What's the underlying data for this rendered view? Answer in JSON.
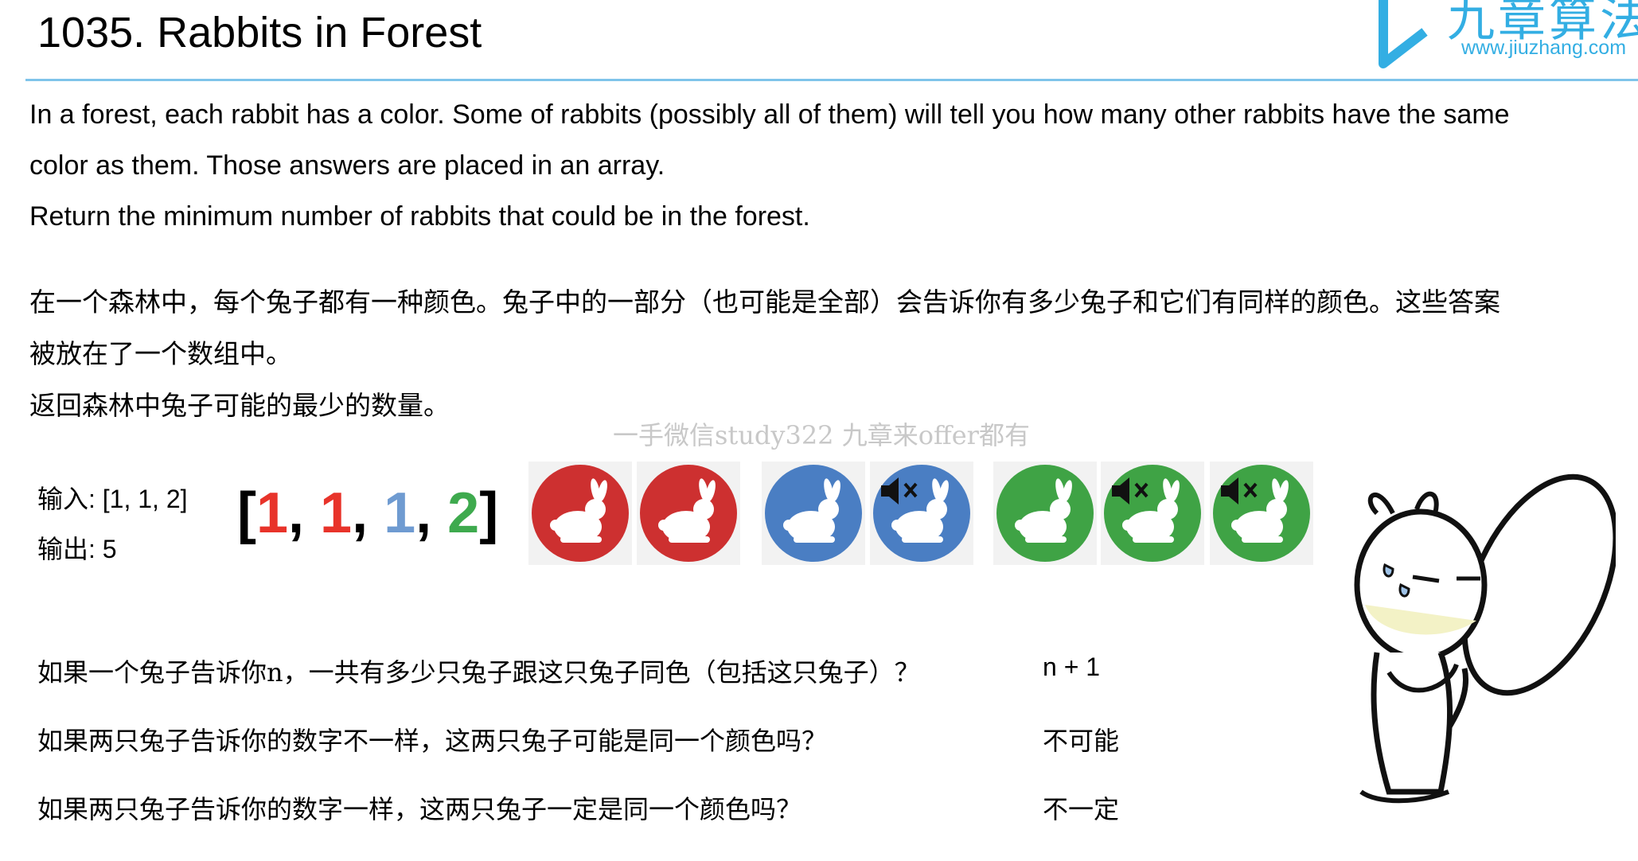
{
  "title": "1035. Rabbits in Forest",
  "logo": {
    "text": "九章算法",
    "url": "www.jiuzhang.com"
  },
  "description_en": [
    "In a forest, each rabbit has a color. Some of rabbits (possibly all of them) will tell you how many other rabbits have the same",
    "color as them. Those answers are placed in an array.",
    "Return the minimum number of rabbits that could be in the forest."
  ],
  "description_cn": [
    "在一个森林中，每个兔子都有一种颜色。兔子中的一部分（也可能是全部）会告诉你有多少兔子和它们有同样的颜色。这些答案",
    "被放在了一个数组中。",
    "返回森林中兔子可能的最少的数量。"
  ],
  "watermark": "一手微信study322 九章来offer都有",
  "example": {
    "input_label": "输入: [1, 1, 2]",
    "output_label": "输出: 5",
    "array": {
      "open": "[",
      "close": "]",
      "sep": ", ",
      "items": [
        {
          "value": "1",
          "color": "#e8332a"
        },
        {
          "value": "1",
          "color": "#e8332a"
        },
        {
          "value": "1",
          "color": "#6f9bd1"
        },
        {
          "value": "2",
          "color": "#3eaa4e"
        }
      ]
    }
  },
  "rabbits": [
    {
      "color": "#cd3030",
      "muted": false
    },
    {
      "color": "#cd3030",
      "muted": false
    },
    {
      "color": "#4a7ec3",
      "muted": false
    },
    {
      "color": "#4a7ec3",
      "muted": true
    },
    {
      "color": "#3fa345",
      "muted": false
    },
    {
      "color": "#3fa345",
      "muted": true
    },
    {
      "color": "#3fa345",
      "muted": true
    }
  ],
  "questions": [
    {
      "q": "如果一个兔子告诉你n，一共有多少只兔子跟这只兔子同色（包括这只兔子）？",
      "a": "n + 1"
    },
    {
      "q": "如果两只兔子告诉你的数字不一样，这两只兔子可能是同一个颜色吗？",
      "a": "不可能"
    },
    {
      "q": "如果两只兔子告诉你的数字一样，这两只兔子一定是同一个颜色吗？",
      "a": "不一定"
    }
  ]
}
